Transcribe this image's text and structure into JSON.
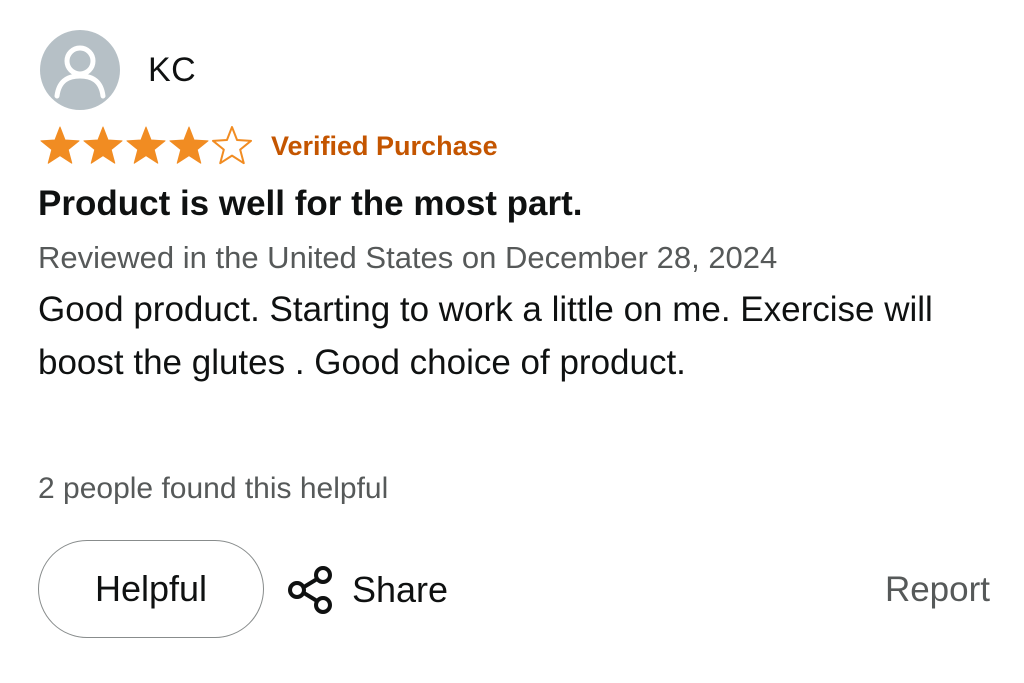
{
  "review": {
    "author": "KC",
    "rating": 4,
    "rating_max": 5,
    "verified_label": "Verified Purchase",
    "title": "Product is well for the most part.",
    "meta": "Reviewed in the United States on December 28, 2024",
    "body": "Good product. Starting to work a little on me. Exercise will boost the glutes . Good choice of product.",
    "helpful_count": "2 people found this helpful"
  },
  "actions": {
    "helpful_label": "Helpful",
    "share_label": "Share",
    "report_label": "Report"
  },
  "icons": {
    "avatar": "user-icon",
    "star_filled": "star-filled-icon",
    "star_empty": "star-empty-icon",
    "share": "share-icon"
  },
  "colors": {
    "star": "#f18c22",
    "verified": "#c45500",
    "avatar_bg": "#b6c0c6",
    "text": "#0f1111",
    "muted": "#565959"
  }
}
